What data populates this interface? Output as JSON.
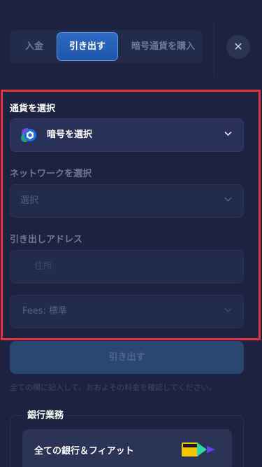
{
  "tabs": [
    {
      "label": "入金",
      "active": false
    },
    {
      "label": "引き出す",
      "active": true
    },
    {
      "label": "暗号通貨を購入",
      "active": false
    }
  ],
  "close": {
    "icon": "close-icon",
    "glyph": "✕"
  },
  "currency": {
    "label": "通貨を選択",
    "value": "暗号を選択",
    "icon": "crypto-coins-icon"
  },
  "network": {
    "label": "ネットワークを選択",
    "placeholder": "選択"
  },
  "address": {
    "label": "引き出しアドレス",
    "placeholder": "住所"
  },
  "fees": {
    "value": "Fees: 標準"
  },
  "withdraw_button": {
    "label": "引き出す"
  },
  "note": "全ての欄に記入して、おおよその料金を確認してください。",
  "banking": {
    "title": "銀行業務",
    "card_label": "全ての銀行＆フィアット",
    "logos": [
      "interac-logo",
      "payment-arrow-logo"
    ]
  },
  "colors": {
    "background": "#1c2340",
    "panel": "#232b4c",
    "accent": "#2d6ac2",
    "highlight_frame": "#e5323b"
  }
}
